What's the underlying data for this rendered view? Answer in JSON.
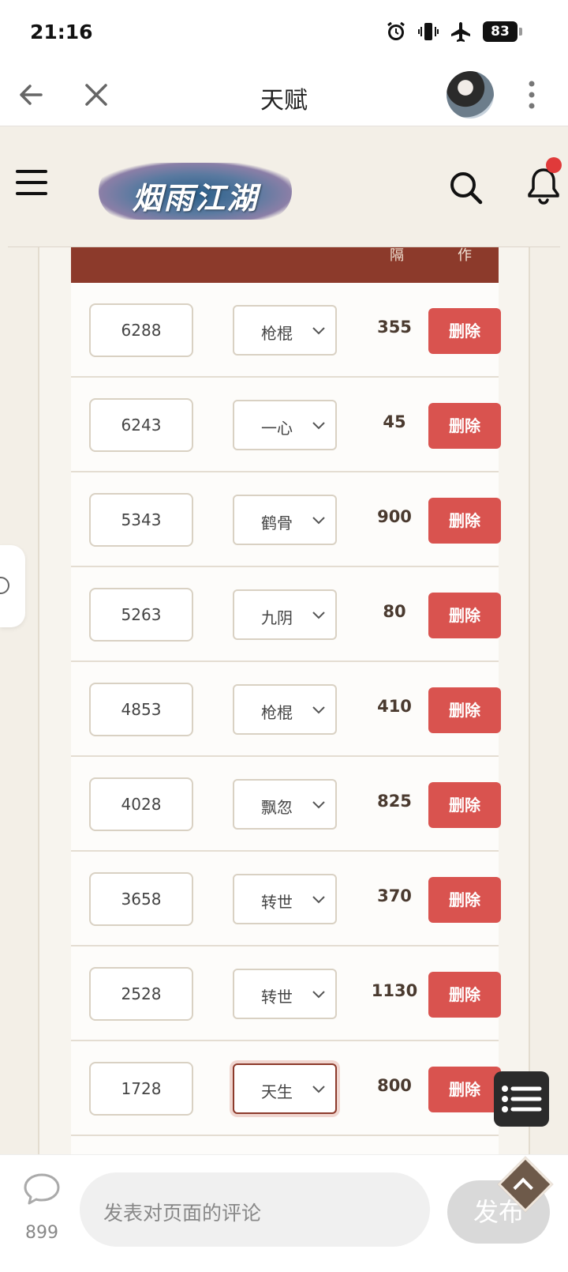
{
  "status_bar": {
    "time": "21:16",
    "battery": "83"
  },
  "app_bar": {
    "title": "天赋"
  },
  "table": {
    "headers": [
      "隔",
      "作"
    ],
    "rows": [
      {
        "id": "6288",
        "type": "枪棍",
        "cost": "355",
        "action": "删除"
      },
      {
        "id": "6243",
        "type": "一心",
        "cost": "45",
        "action": "删除"
      },
      {
        "id": "5343",
        "type": "鹤骨",
        "cost": "900",
        "action": "删除"
      },
      {
        "id": "5263",
        "type": "九阴",
        "cost": "80",
        "action": "删除"
      },
      {
        "id": "4853",
        "type": "枪棍",
        "cost": "410",
        "action": "删除"
      },
      {
        "id": "4028",
        "type": "飘忽",
        "cost": "825",
        "action": "删除"
      },
      {
        "id": "3658",
        "type": "转世",
        "cost": "370",
        "action": "删除"
      },
      {
        "id": "2528",
        "type": "转世",
        "cost": "1130",
        "action": "删除"
      },
      {
        "id": "1728",
        "type": "天生",
        "cost": "800",
        "action": "删除"
      }
    ]
  },
  "site_header": {
    "logo_text": "烟雨江湖"
  },
  "comment_bar": {
    "count": "899",
    "placeholder": "发表对页面的评论",
    "publish_label": "发布"
  },
  "colors": {
    "header_red": "#8c3a2b",
    "delete_red": "#d9534f",
    "notification_dot": "#e03a3a"
  }
}
